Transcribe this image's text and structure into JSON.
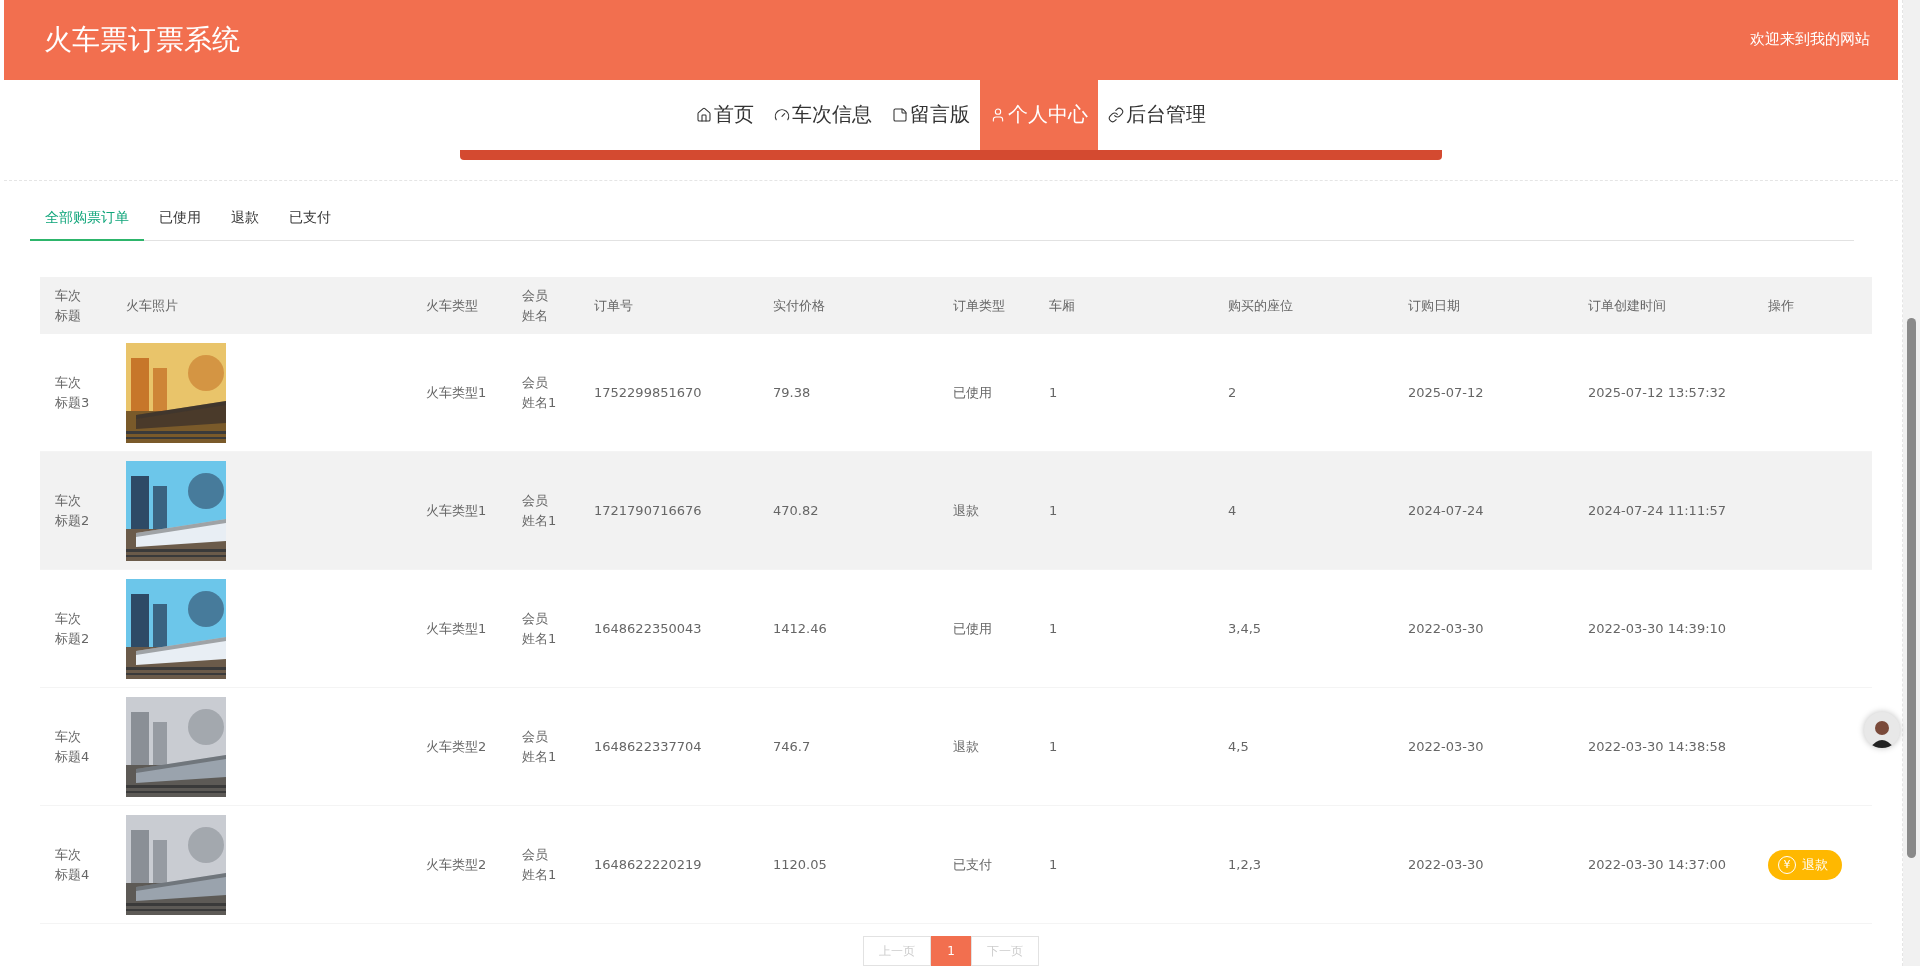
{
  "header": {
    "title": "火车票订票系统",
    "welcome": "欢迎来到我的网站"
  },
  "nav": [
    {
      "label": "首页",
      "selected": false
    },
    {
      "label": "车次信息",
      "selected": false
    },
    {
      "label": "留言版",
      "selected": false
    },
    {
      "label": "个人中心",
      "selected": true
    },
    {
      "label": "后台管理",
      "selected": false
    }
  ],
  "tabs": [
    {
      "label": "全部购票订单",
      "selected": true
    },
    {
      "label": "已使用",
      "selected": false
    },
    {
      "label": "退款",
      "selected": false
    },
    {
      "label": "已支付",
      "selected": false
    }
  ],
  "table": {
    "columns": [
      "车次标题",
      "火车照片",
      "火车类型",
      "会员姓名",
      "订单号",
      "实付价格",
      "订单类型",
      "车厢",
      "购买的座位",
      "订购日期",
      "订单创建时间",
      "操作"
    ],
    "rows": [
      {
        "title": "车次标题3",
        "train_type": "火车类型1",
        "member": "会员姓名1",
        "order_no": "1752299851670",
        "price": "79.38",
        "order_type": "已使用",
        "carriage": "1",
        "seats": "2",
        "date": "2025-07-12",
        "created": "2025-07-12 13:57:32",
        "highlighted": false
      },
      {
        "title": "车次标题2",
        "train_type": "火车类型1",
        "member": "会员姓名1",
        "order_no": "1721790716676",
        "price": "470.82",
        "order_type": "退款",
        "carriage": "1",
        "seats": "4",
        "date": "2024-07-24",
        "created": "2024-07-24 11:11:57",
        "highlighted": true
      },
      {
        "title": "车次标题2",
        "train_type": "火车类型1",
        "member": "会员姓名1",
        "order_no": "1648622350043",
        "price": "1412.46",
        "order_type": "已使用",
        "carriage": "1",
        "seats": "3,4,5",
        "date": "2022-03-30",
        "created": "2022-03-30 14:39:10",
        "highlighted": false
      },
      {
        "title": "车次标题4",
        "train_type": "火车类型2",
        "member": "会员姓名1",
        "order_no": "1648622337704",
        "price": "746.7",
        "order_type": "退款",
        "carriage": "1",
        "seats": "4,5",
        "date": "2022-03-30",
        "created": "2022-03-30 14:38:58",
        "highlighted": false
      },
      {
        "title": "车次标题4",
        "train_type": "火车类型2",
        "member": "会员姓名1",
        "order_no": "1648622220219",
        "price": "1120.05",
        "order_type": "已支付",
        "carriage": "1",
        "seats": "1,2,3",
        "date": "2022-03-30",
        "created": "2022-03-30 14:37:00",
        "highlighted": false,
        "action": {
          "icon": "¥",
          "label": "退款"
        }
      }
    ]
  },
  "pagination": {
    "prev": "上一页",
    "pages": [
      {
        "label": "1",
        "selected": true
      }
    ],
    "next": "下一页"
  }
}
